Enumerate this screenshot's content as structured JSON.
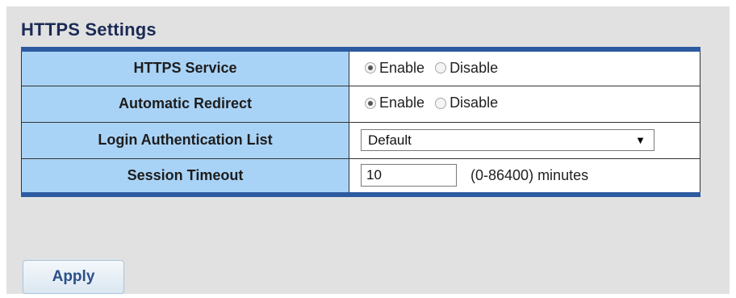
{
  "section": {
    "title": "HTTPS Settings"
  },
  "rows": {
    "https_service": {
      "label": "HTTPS Service",
      "options": [
        "Enable",
        "Disable"
      ],
      "selected": "Enable"
    },
    "automatic_redirect": {
      "label": "Automatic Redirect",
      "options": [
        "Enable",
        "Disable"
      ],
      "selected": "Enable"
    },
    "login_auth_list": {
      "label": "Login Authentication List",
      "value": "Default"
    },
    "session_timeout": {
      "label": "Session Timeout",
      "value": "10",
      "unit": "(0-86400) minutes"
    }
  },
  "apply_label": "Apply",
  "colors": {
    "label_bg": "#a9d3f6",
    "table_border": "#2c5aa0",
    "title": "#1a2b55",
    "apply_text": "#2a4f8a"
  },
  "icons": {
    "select_arrow": "chevron-down-icon"
  }
}
